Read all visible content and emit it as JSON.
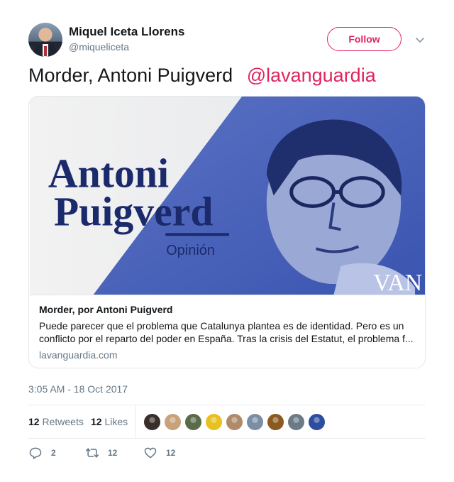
{
  "user": {
    "name": "Miquel Iceta Llorens",
    "handle": "@miqueliceta",
    "follow_label": "Follow"
  },
  "tweet": {
    "text": "Morder, Antoni Puigverd",
    "mention": "@lavanguardia",
    "timestamp": "3:05 AM - 18 Oct 2017"
  },
  "card": {
    "image_headline_line1": "Antoni",
    "image_headline_line2": "Puigverd",
    "image_section": "Opinión",
    "image_logo": "VAN",
    "title": "Morder, por Antoni Puigverd",
    "description": "Puede parecer que el problema que Catalunya plantea es de identidad. Pero es un conflicto por el reparto del poder en España. Tras la crisis del Estatut, el problema f...",
    "domain": "lavanguardia.com"
  },
  "stats": {
    "retweets_count": "12",
    "retweets_label": "Retweets",
    "likes_count": "12",
    "likes_label": "Likes"
  },
  "likers": [
    {
      "color": "#3a2e2a"
    },
    {
      "color": "#c9a27c"
    },
    {
      "color": "#5a6b4a"
    },
    {
      "color": "#e8c020"
    },
    {
      "color": "#b08a6a"
    },
    {
      "color": "#7a8fa6"
    },
    {
      "color": "#8a5a20"
    },
    {
      "color": "#6a7a86"
    },
    {
      "color": "#2c4da0"
    }
  ],
  "actions": {
    "reply_count": "2",
    "retweet_count": "12",
    "like_count": "12"
  },
  "colors": {
    "accent": "#e0245e",
    "secondary_text": "#657786",
    "border": "#e1e8ed"
  }
}
